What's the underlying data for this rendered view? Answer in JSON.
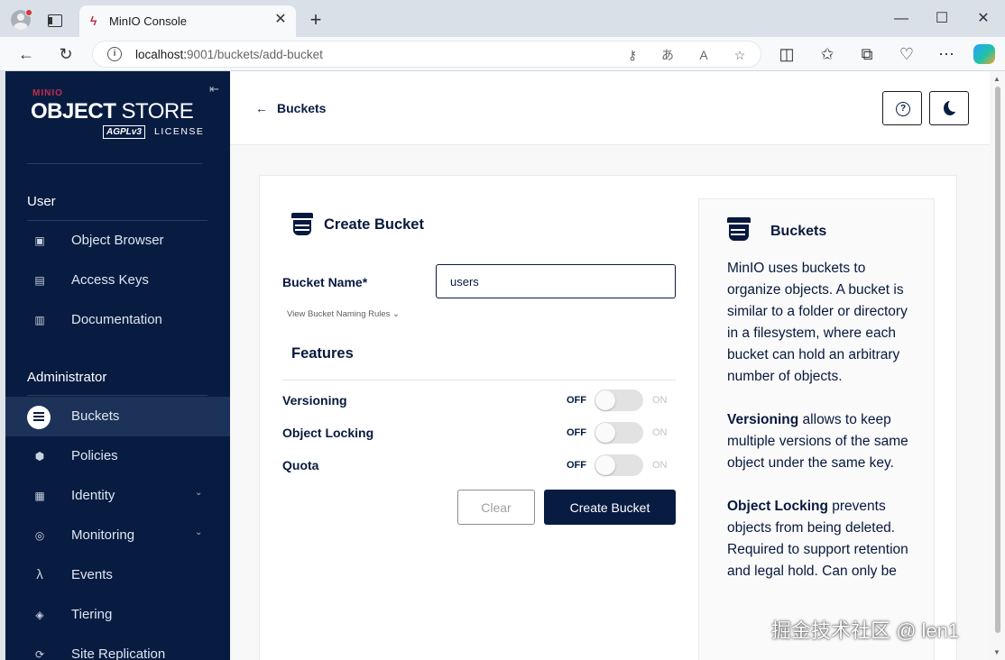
{
  "browser": {
    "tab_title": "MinIO Console",
    "url_host": "localhost:",
    "url_rest": "9001/buckets/add-bucket",
    "new_tab_glyph": "+",
    "close_glyph": "✕"
  },
  "sidebar": {
    "logo_small": "MINIO",
    "logo_object": "OBJECT",
    "logo_store": " STORE",
    "logo_agpl": "AGPLv3",
    "logo_license": "LICENSE",
    "section_user": "User",
    "user_items": [
      {
        "label": "Object Browser",
        "icon": "object-browser-icon"
      },
      {
        "label": "Access Keys",
        "icon": "access-keys-icon"
      },
      {
        "label": "Documentation",
        "icon": "documentation-icon"
      }
    ],
    "section_admin": "Administrator",
    "admin_items": [
      {
        "label": "Buckets",
        "icon": "buckets-icon",
        "active": true
      },
      {
        "label": "Policies",
        "icon": "policies-icon"
      },
      {
        "label": "Identity",
        "icon": "identity-icon",
        "expandable": true
      },
      {
        "label": "Monitoring",
        "icon": "monitoring-icon",
        "expandable": true
      },
      {
        "label": "Events",
        "icon": "lambda-icon"
      },
      {
        "label": "Tiering",
        "icon": "tiering-icon"
      },
      {
        "label": "Site Replication",
        "icon": "site-replication-icon"
      }
    ]
  },
  "header": {
    "back_label": "Buckets"
  },
  "form": {
    "title": "Create Bucket",
    "bucket_name_label": "Bucket Name*",
    "bucket_name_value": "users",
    "naming_rules_link": "View Bucket Naming Rules",
    "features_title": "Features",
    "features": [
      {
        "label": "Versioning",
        "off": "OFF",
        "on": "ON",
        "enabled": false
      },
      {
        "label": "Object Locking",
        "off": "OFF",
        "on": "ON",
        "enabled": false
      },
      {
        "label": "Quota",
        "off": "OFF",
        "on": "ON",
        "enabled": false
      }
    ],
    "clear_label": "Clear",
    "create_label": "Create Bucket"
  },
  "info": {
    "title": "Buckets",
    "p1": "MinIO uses buckets to organize objects. A bucket is similar to a folder or directory in a filesystem, where each bucket can hold an arbitrary number of objects.",
    "p2_bold": "Versioning",
    "p2": " allows to keep multiple versions of the same object under the same key.",
    "p3_bold": "Object Locking",
    "p3": " prevents objects from being deleted. Required to support retention and legal hold. Can only be"
  },
  "watermark": "掘金技术社区 @ len1",
  "colors": {
    "sidebar_bg": "#081c42",
    "primary": "#081c42",
    "brand_red": "#c72c48"
  }
}
